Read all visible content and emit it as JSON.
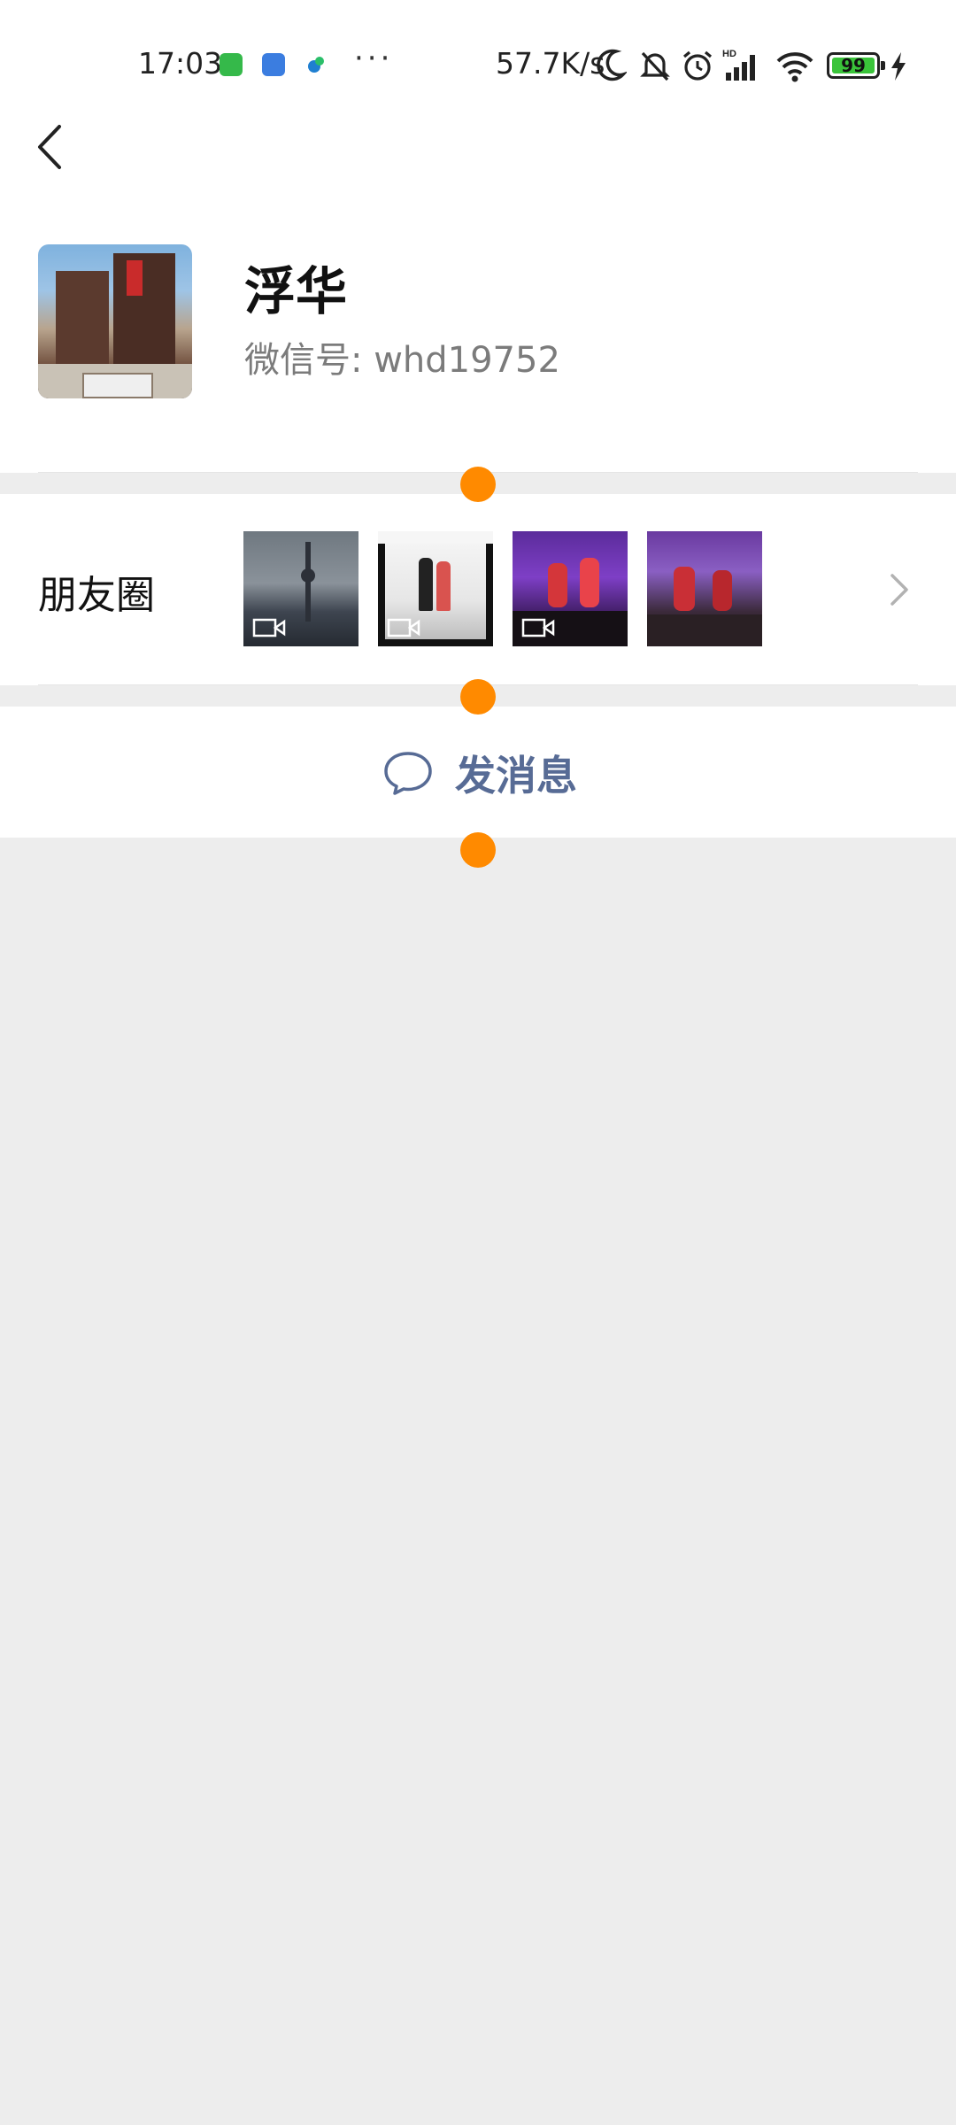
{
  "status_bar": {
    "time": "17:03",
    "more": "···",
    "network_speed": "57.7K/s",
    "hd": "HD",
    "battery": "99"
  },
  "profile": {
    "nickname": "浮华",
    "wechat_id": "微信号:  whd19752"
  },
  "moments": {
    "label": "朋友圈",
    "thumbnails": [
      {
        "name": "city-tower",
        "is_video": true
      },
      {
        "name": "couple-poster",
        "is_video": true
      },
      {
        "name": "stage-performance",
        "is_video": true
      },
      {
        "name": "stage-crowd",
        "is_video": false
      }
    ]
  },
  "actions": {
    "send_message": "发消息"
  },
  "colors": {
    "link": "#576b95",
    "marker": "#ff8a00",
    "background": "#ededed"
  }
}
